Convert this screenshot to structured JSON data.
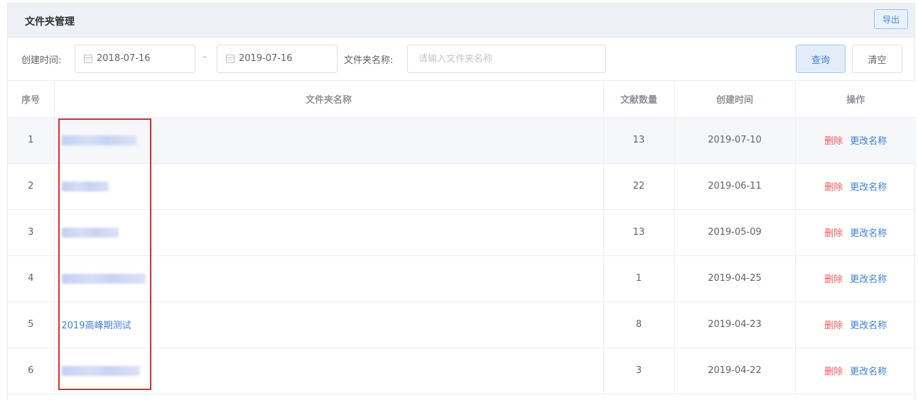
{
  "panel": {
    "title": "文件夹管理",
    "export_label": "导出"
  },
  "filter": {
    "created_label": "创建时间:",
    "date_from": "2018-07-16",
    "date_sep": "-",
    "date_to": "2019-07-16",
    "folder_name_label": "文件夹名称:",
    "folder_name_placeholder": "请输入文件夹名称",
    "folder_name_value": "",
    "query_label": "查询",
    "clear_label": "清空"
  },
  "table": {
    "headers": {
      "index": "序号",
      "name": "文件夹名称",
      "count": "文献数量",
      "created": "创建时间",
      "ops": "操作"
    },
    "rows": [
      {
        "index": "1",
        "name": "",
        "count": "13",
        "created": "2019-07-10"
      },
      {
        "index": "2",
        "name": "",
        "count": "22",
        "created": "2019-06-11"
      },
      {
        "index": "3",
        "name": "",
        "count": "13",
        "created": "2019-05-09"
      },
      {
        "index": "4",
        "name": "",
        "count": "1",
        "created": "2019-04-25"
      },
      {
        "index": "5",
        "name": "2019高峰期测试",
        "count": "8",
        "created": "2019-04-23"
      },
      {
        "index": "6",
        "name": "",
        "count": "3",
        "created": "2019-04-22"
      }
    ],
    "ops": {
      "delete_label": "删除",
      "rename_label": "更改名称"
    }
  },
  "colors": {
    "link": "#3e7fd5",
    "delete": "#f05a5a",
    "annotation_box": "#e02b2b"
  }
}
